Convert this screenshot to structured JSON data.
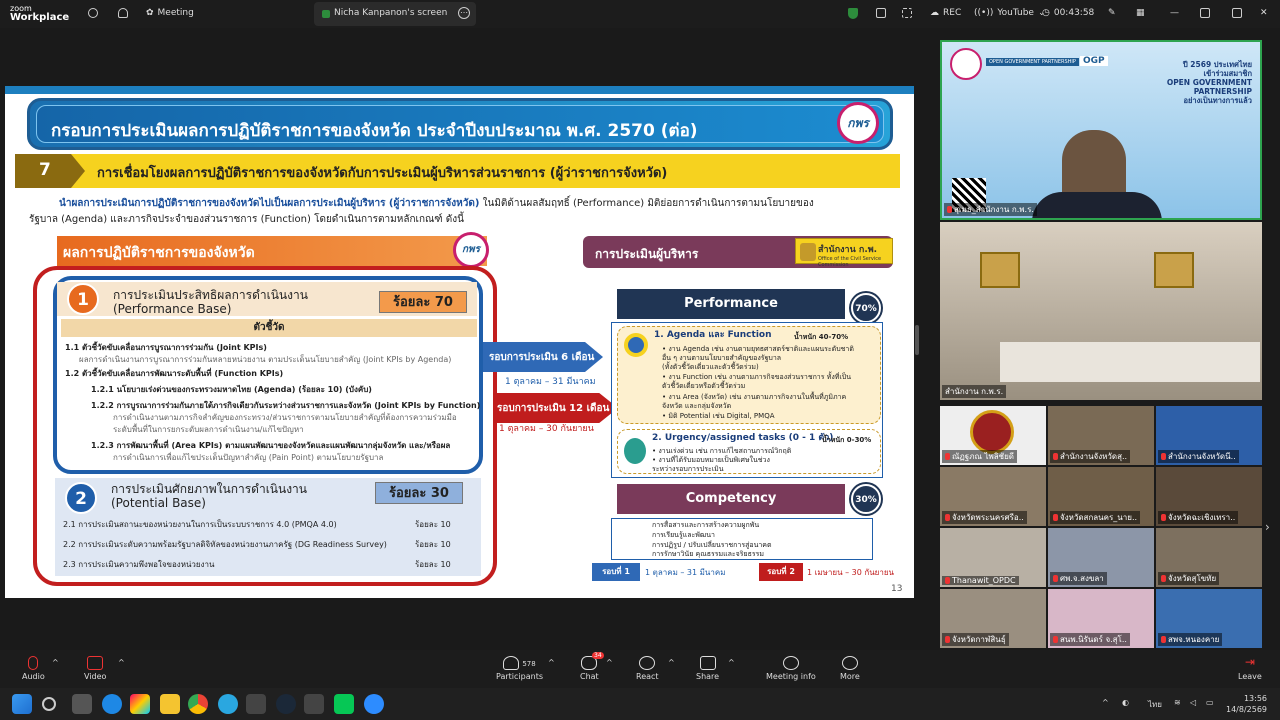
{
  "app": {
    "logo_line1": "zoom",
    "logo_line2": "Workplace",
    "meeting_label": "Meeting"
  },
  "share_tab": {
    "label": "Nicha Kanpanon's screen"
  },
  "top_right": {
    "rec": "REC",
    "youtube": "YouTube",
    "timer": "00:43:58"
  },
  "slide": {
    "title": "กรอบการประเมินผลการปฏิบัติราชการของจังหวัด ประจำปีงบประมาณ พ.ศ. 2570 (ต่อ)",
    "logo_text": "กพร",
    "section_num": "7",
    "section_title": "การเชื่อมโยงผลการปฏิบัติราชการของจังหวัดกับการประเมินผู้บริหารส่วนราชการ (ผู้ว่าราชการจังหวัด)",
    "intro_blue": "นำผลการประเมินการปฏิบัติราชการของจังหวัดไปเป็นผลการประเมินผู้บริหาร (ผู้ว่าราชการจังหวัด)",
    "intro_rest": " ในมิติด้านผลสัมฤทธิ์ (Performance) มิติย่อยการดำเนินการตามนโยบายของ",
    "intro_line2": "รัฐบาล (Agenda) และภารกิจประจำของส่วนราชการ (Function) โดยดำเนินการตามหลักเกณฑ์ ดังนี้",
    "left_head": "ผลการปฏิบัติราชการของจังหวัด",
    "blk1_num": "1",
    "blk1_title": "การประเมินประสิทธิผลการดำเนินงาน",
    "blk1_sub": "(Performance Base)",
    "blk1_pct": "ร้อยละ 70",
    "kpi_head": "ตัวชี้วัด",
    "kpi": [
      "1.1 ตัวชี้วัดขับเคลื่อนการบูรณาการร่วมกัน (Joint KPIs)",
      "ผลการดำเนินงานการบูรณาการร่วมกันหลายหน่วยงาน ตามประเด็นนโยบายสำคัญ (Joint KPIs by Agenda)",
      "1.2 ตัวชี้วัดขับเคลื่อนการพัฒนาระดับพื้นที่ (Function KPIs)",
      "1.2.1 นโยบายเร่งด่วนของกระทรวงมหาดไทย (Agenda) (ร้อยละ 10) (บังคับ)",
      "1.2.2 การบูรณาการร่วมกันภายใต้ภารกิจเดียวกันระหว่างส่วนราชการและจังหวัด (Joint KPIs by Function)",
      "การดำเนินงานตามภารกิจสำคัญของกระทรวง/ส่วนราชการตามนโยบายสำคัญที่ต้องการความร่วมมือ",
      "ระดับพื้นที่ในการยกระดับผลการดำเนินงาน/แก้ไขปัญหา",
      "1.2.3 การพัฒนาพื้นที่ (Area KPIs) ตามแผนพัฒนาของจังหวัดและแผนพัฒนากลุ่มจังหวัด และ/หรือผล",
      "การดำเนินการเพื่อแก้ไขประเด็นปัญหาสำคัญ (Pain Point) ตามนโยบายรัฐบาล"
    ],
    "blk2_num": "2",
    "blk2_title": "การประเมินศักยภาพในการดำเนินงาน",
    "blk2_sub": "(Potential Base)",
    "blk2_pct": "ร้อยละ 30",
    "blk2_rows": [
      {
        "label": "2.1 การประเมินสถานะของหน่วยงานในการเป็นระบบราชการ 4.0 (PMQA 4.0)",
        "value": "ร้อยละ 10"
      },
      {
        "label": "2.2 การประเมินระดับความพร้อมรัฐบาลดิจิทัลของหน่วยงานภาครัฐ (DG Readiness Survey)",
        "value": "ร้อยละ 10"
      },
      {
        "label": "2.3 การประเมินความพึงพอใจของหน่วยงาน",
        "value": "ร้อยละ 10"
      }
    ],
    "arrow1": "รอบการประเมิน 6 เดือน",
    "arrow1_date": "1 ตุลาคม – 31 มีนาคม",
    "arrow2": "รอบการประเมิน 12 เดือน",
    "arrow2_date": "1 ตุลาคม – 30 กันยายน",
    "right_head": "การประเมินผู้บริหาร",
    "ocsc": "สำนักงาน ก.พ.",
    "ocsc_sub": "Office of the Civil Service Commission",
    "perf_head": "Performance",
    "perf_pct": "70%",
    "agenda_title": "1. Agenda และ Function",
    "agenda_weight": "น้ำหนัก 40-70%",
    "agenda_lines": [
      "• งาน Agenda เช่น งานตามยุทธศาสตร์ชาติและแผนระดับชาติ",
      "  อื่น ๆ งานตามนโยบายสำคัญของรัฐบาล",
      "  (ทั้งตัวชี้วัดเดี่ยวและตัวชี้วัดร่วม)",
      "• งาน Function เช่น งานตามภารกิจของส่วนราชการ ทั้งที่เป็น",
      "  ตัวชี้วัดเดี่ยวหรือตัวชี้วัดร่วม",
      "• งาน Area (จังหวัด) เช่น งานตามภารกิจงานในพื้นที่ภูมิภาค",
      "  จังหวัด และกลุ่มจังหวัด",
      "• มิติ Potential เช่น Digital, PMQA"
    ],
    "urg_title": "2. Urgency/assigned tasks (0 - 1 ตัว)",
    "urg_weight": "น้ำหนัก 0-30%",
    "urg_lines": [
      "• งานเร่งด่วน เช่น การแก้ไขสถานการณ์วิกฤติ",
      "• งานที่ได้รับมอบหมายเป็นพิเศษในช่วง",
      "  ระหว่างรอบการประเมิน"
    ],
    "comp_head": "Competency",
    "comp_pct": "30%",
    "comp_lines": [
      "การสื่อสารและการสร้างความผูกพัน",
      "การเรียนรู้และพัฒนา",
      "การปฏิรูป / ปรับเปลี่ยนราชการสู่อนาคต",
      "การรักษาวินัย คุณธรรมและจริยธรรม"
    ],
    "r1": "รอบที่ 1",
    "r1_date": "1 ตุลาคม – 31 มีนาคม",
    "r2": "รอบที่ 2",
    "r2_date": "1 เมษายน – 30 กันยายน",
    "page": "13"
  },
  "right_panel": {
    "ogp_text": "OPEN GOVERNMENT PARTNERSHIP",
    "ogp_abbr": "OGP",
    "ogp_lines": [
      "ปี 2569 ประเทศไทย",
      "เข้าร่วมสมาชิก",
      "OPEN GOVERNMENT",
      "PARTNERSHIP",
      "อย่างเป็นทางการแล้ว"
    ],
    "speaker_label": "สุเมธ_สำนักงาน ก.พ.ร.",
    "room_label": "สำนักงาน ก.พ.ร.",
    "tiles": [
      "ณัฏฐภณ ไพลิชัยดี",
      "สำนักงานจังหวัดสุ..",
      "สำนักงานจังหวัดนี..",
      "จังหวัดพระนครศรีอ..",
      "จังหวัดสกลนคร_นาย..",
      "จังหวัดฉะเชิงเทรา..",
      "Thanawit_OPDC",
      "ศพ.จ.สงขลา",
      "จังหวัดสุโขทัย",
      "จังหวัดกาฬสินธุ์",
      "สนพ.นิรันดร์ จ.สุโ..",
      "สพจ.หนองคาย"
    ]
  },
  "bottom_bar": {
    "audio": "Audio",
    "video": "Video",
    "participants": "Participants",
    "participants_count": "578",
    "chat": "Chat",
    "chat_badge": "34",
    "react": "React",
    "share": "Share",
    "meeting_info": "Meeting info",
    "more": "More",
    "leave": "Leave"
  },
  "taskbar": {
    "lang": "ไทย",
    "time": "13:56",
    "date": "14/8/2569"
  }
}
